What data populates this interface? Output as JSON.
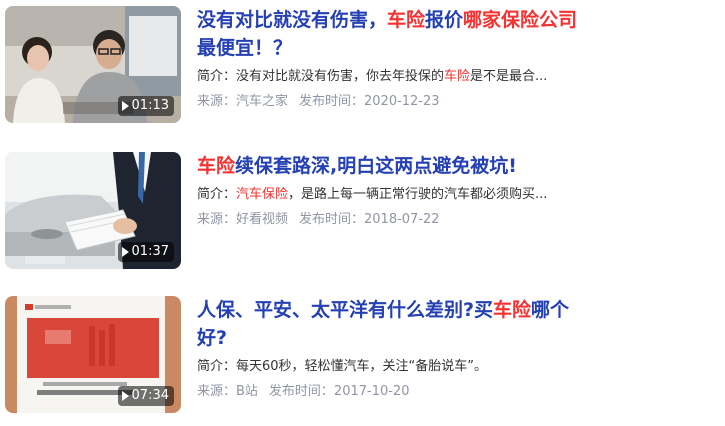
{
  "colors": {
    "title": "#2440b3",
    "highlight": "#f73131",
    "summary": "#333333",
    "meta": "#9195a3"
  },
  "results": [
    {
      "title_parts": [
        {
          "text": "没有对比就没有伤害，",
          "hl": false
        },
        {
          "text": "车险",
          "hl": true
        },
        {
          "text": "报价",
          "hl": false
        },
        {
          "text": "哪家保险公司",
          "hl": true
        },
        {
          "text": "最便宜！？",
          "hl": false
        }
      ],
      "summary_parts": [
        {
          "text": "简介：没有对比就没有伤害，你去年投保的",
          "hl": false
        },
        {
          "text": "车险",
          "hl": true
        },
        {
          "text": "是不是最合...",
          "hl": false
        }
      ],
      "source": "来源：汽车之家",
      "date": "发布时间：2020-12-23",
      "duration": "01:13",
      "thumb_icon": "video-thumbnail-two-hosts-icon"
    },
    {
      "title_parts": [
        {
          "text": "车险",
          "hl": true
        },
        {
          "text": "续保套路深,明白这两点避免被坑!",
          "hl": false
        }
      ],
      "summary_parts": [
        {
          "text": "简介：",
          "hl": false
        },
        {
          "text": "汽车保险",
          "hl": true
        },
        {
          "text": "，是路上每一辆正常行驶的汽车都必须购买...",
          "hl": false
        }
      ],
      "source": "来源：好看视频",
      "date": "发布时间：2018-07-22",
      "duration": "01:37",
      "thumb_icon": "video-thumbnail-car-document-icon"
    },
    {
      "title_parts": [
        {
          "text": "人保、平安、太平洋有什么差别?买",
          "hl": false
        },
        {
          "text": "车险",
          "hl": true
        },
        {
          "text": "哪个好?",
          "hl": false
        }
      ],
      "summary_parts": [
        {
          "text": "简介：每天60秒，轻松懂汽车，关注“备胎说车”。",
          "hl": false
        }
      ],
      "source": "来源：B站",
      "date": "发布时间：2017-10-20",
      "duration": "07:34",
      "thumb_icon": "video-thumbnail-policy-document-icon"
    }
  ]
}
